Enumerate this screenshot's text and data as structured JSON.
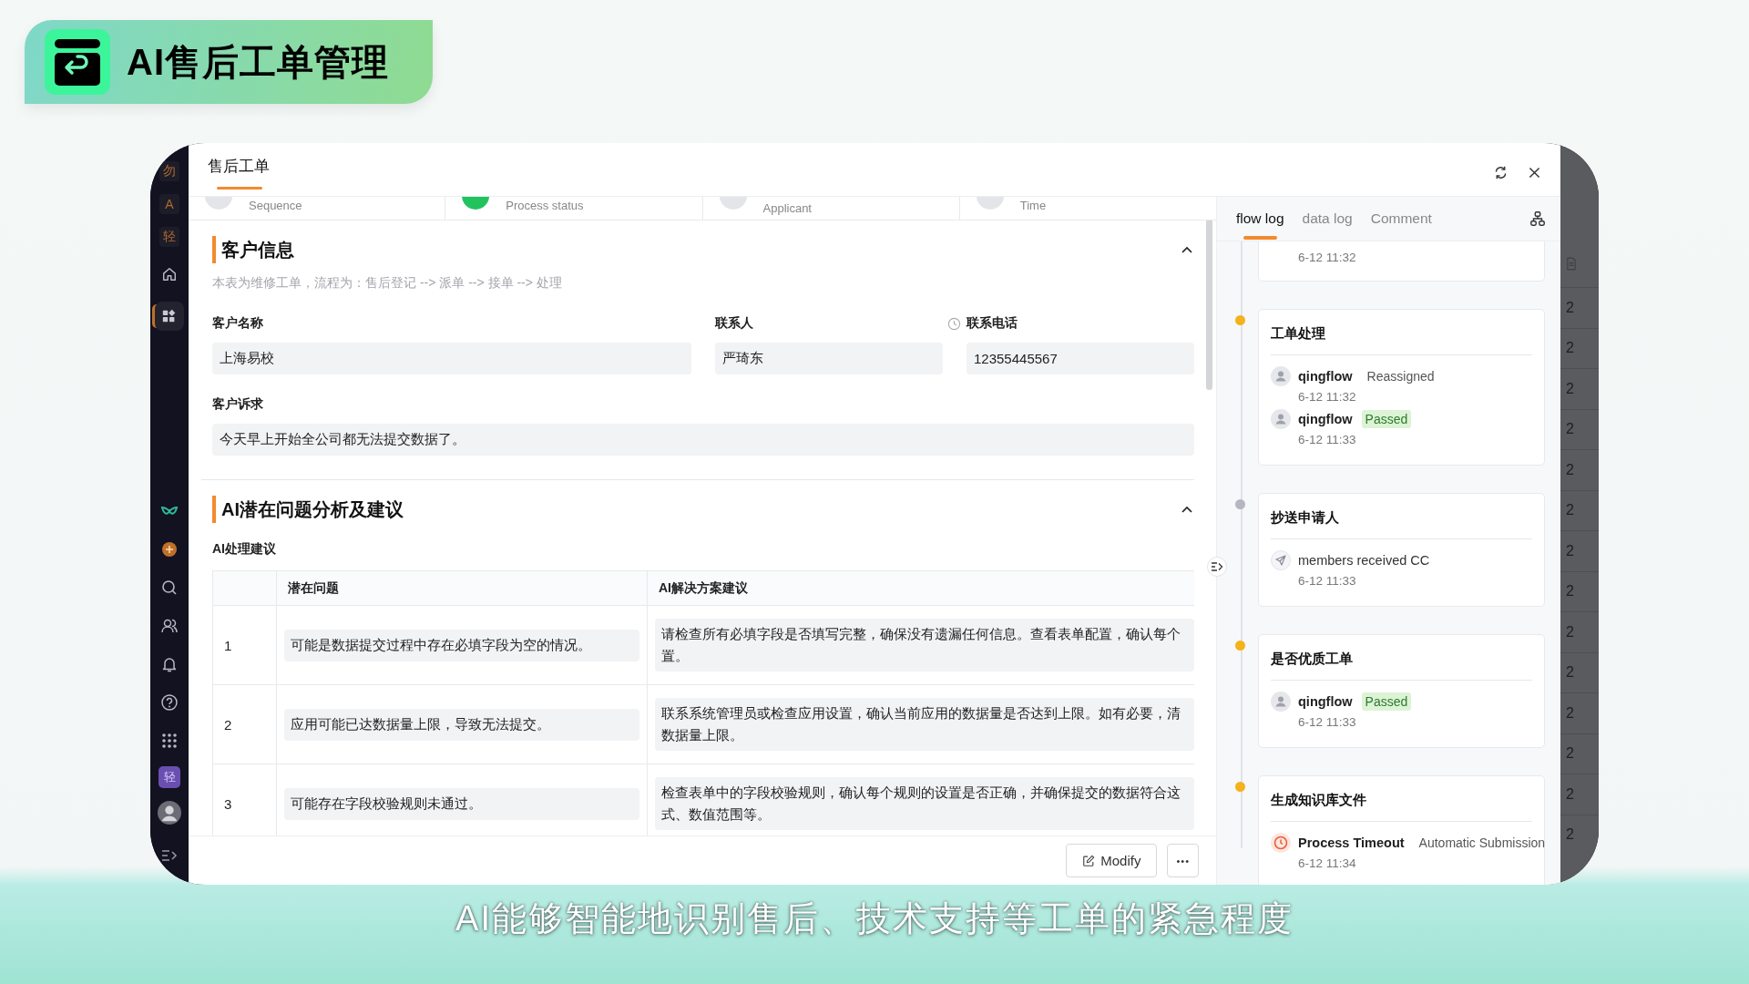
{
  "banner": {
    "title": "AI售后工单管理"
  },
  "sidebar": {
    "letters": [
      "勿",
      "A",
      "轻"
    ],
    "nav": [
      {
        "kind": "home",
        "selected": false
      },
      {
        "kind": "apps",
        "selected": true
      }
    ],
    "tools": [
      {
        "kind": "logo"
      },
      {
        "kind": "add"
      },
      {
        "kind": "search"
      },
      {
        "kind": "users"
      },
      {
        "kind": "bell"
      },
      {
        "kind": "help"
      },
      {
        "kind": "grid"
      }
    ],
    "badge": "轻"
  },
  "modal": {
    "title": "售后工单",
    "steps": [
      {
        "label": "Sequence",
        "color": "#e4e5e9"
      },
      {
        "label": "Process status",
        "color": "#22c35e"
      },
      {
        "label": "Applicant",
        "color": "#e4e5e9"
      },
      {
        "label": "Time",
        "color": "#e4e5e9"
      }
    ],
    "customer": {
      "title": "客户信息",
      "expanded": true,
      "description": "本表为维修工单，流程为：售后登记 --> 派单 --> 接单 --> 处理",
      "fields": [
        {
          "label": "客户名称",
          "value": "上海易校"
        },
        {
          "label": "联系人",
          "value": "严琦东"
        },
        {
          "label": "联系电话",
          "value": "12355445567"
        }
      ],
      "request": {
        "label": "客户诉求",
        "value": "今天早上开始全公司都无法提交数据了。"
      }
    },
    "analysis": {
      "title": "AI潜在问题分析及建议",
      "expanded": true,
      "subtitle": "AI处理建议",
      "columns": [
        "潜在问题",
        "AI解决方案建议"
      ],
      "rows": [
        {
          "index": "1",
          "problem": "可能是数据提交过程中存在必填字段为空的情况。",
          "solution": [
            "请检查所有必填字段是否填写完整，确保没有遗漏任何信息。查看表单配置，确认每个",
            "置。"
          ]
        },
        {
          "index": "2",
          "problem": "应用可能已达数据量上限，导致无法提交。",
          "solution": [
            "联系系统管理员或检查应用设置，确认当前应用的数据量是否达到上限。如有必要，清",
            "数据量上限。"
          ]
        },
        {
          "index": "3",
          "problem": "可能存在字段校验规则未通过。",
          "solution": [
            "检查表单中的字段校验规则，确认每个规则的设置是否正确，并确保提交的数据符合这",
            "式、数值范围等。"
          ]
        }
      ]
    },
    "actions": {
      "modify": "Modify",
      "more": "•••"
    }
  },
  "log": {
    "tabs": [
      {
        "label": "flow log",
        "selected": true
      },
      {
        "label": "data log",
        "selected": false
      },
      {
        "label": "Comment",
        "selected": false
      }
    ],
    "cards": [
      {
        "entries": [
          {
            "time": "6-12 11:32"
          }
        ]
      },
      {
        "title": "工单处理",
        "color": "#f4b21b",
        "entries": [
          {
            "kind": "user",
            "name": "qingflow",
            "action": "Reassigned",
            "tag": false,
            "time": "6-12 11:32"
          },
          {
            "kind": "user",
            "name": "qingflow",
            "action": "Passed",
            "tag": true,
            "time": "6-12 11:33"
          }
        ]
      },
      {
        "title": "抄送申请人",
        "color": "#b4b6c2",
        "entries": [
          {
            "kind": "cc",
            "text": "members received CC",
            "time": "6-12 11:33"
          }
        ]
      },
      {
        "title": "是否优质工单",
        "color": "#f4b21b",
        "entries": [
          {
            "kind": "user",
            "name": "qingflow",
            "action": "Passed",
            "tag": true,
            "time": "6-12 11:33"
          }
        ]
      },
      {
        "title": "生成知识库文件",
        "color": "#f4b21b",
        "entries": [
          {
            "kind": "timeout",
            "name": "Process Timeout",
            "action": "Automatic Submission",
            "tag": false,
            "time": "6-12 11:34"
          }
        ]
      }
    ]
  },
  "backdrop": {
    "cells": [
      "2",
      "2",
      "2",
      "2",
      "2",
      "2",
      "2",
      "2",
      "2",
      "2",
      "2",
      "2",
      "2",
      "2"
    ]
  },
  "caption": "AI能够智能地识别售后、技术支持等工单的紧急程度"
}
